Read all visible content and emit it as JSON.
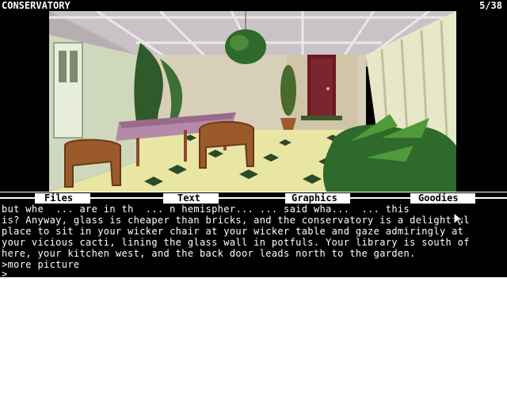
{
  "status": {
    "location": "CONSERVATORY",
    "score": "5/38"
  },
  "menus": [
    {
      "label": "Files"
    },
    {
      "label": "Text"
    },
    {
      "label": "Graphics"
    },
    {
      "label": "Goodies"
    }
  ],
  "text_lines": [
    "but whe  ... are in th  ... n hemispher... ... said wha...  ... this",
    "is? Anyway, glass is cheaper than bricks, and the conservatory is a delightful",
    "place to sit in your wicker chair at your wicker table and gaze admiringly at",
    "your vicious cacti, lining the glass wall in potfuls. Your library is south of",
    "here, your kitchen west, and the back door leads north to the garden.",
    ">more picture",
    ">"
  ],
  "colors": {
    "accent": "#ffffff",
    "background": "#000000",
    "text": "#ffffff"
  }
}
